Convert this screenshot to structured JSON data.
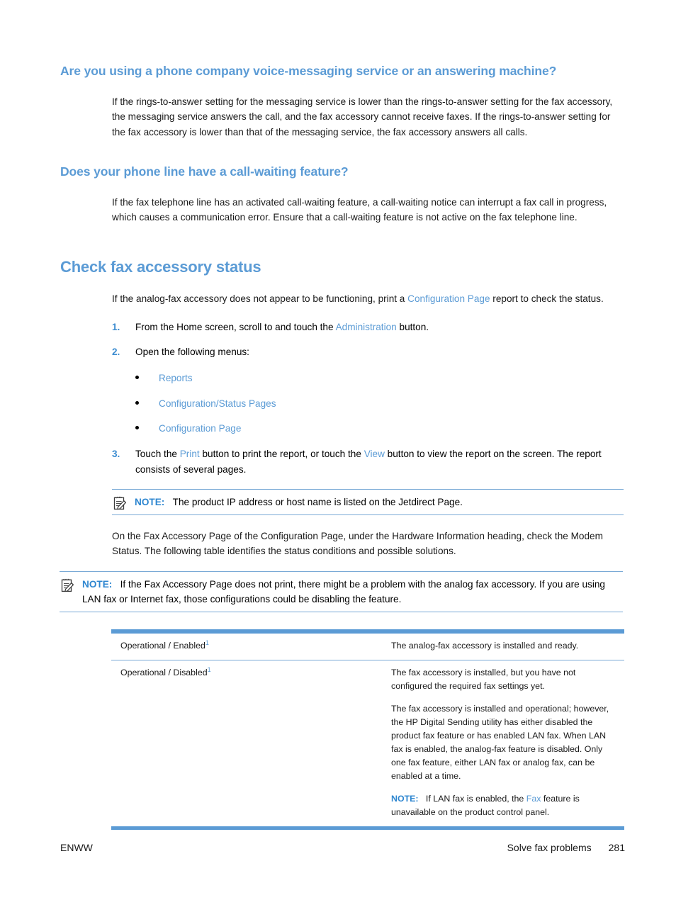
{
  "sections": [
    {
      "heading": "Are you using a phone company voice-messaging service or an answering machine?",
      "body": "If the rings-to-answer setting for the messaging service is lower than the rings-to-answer setting for the fax accessory, the messaging service answers the call, and the fax accessory cannot receive faxes. If the rings-to-answer setting for the fax accessory is lower than that of the messaging service, the fax accessory answers all calls."
    },
    {
      "heading": "Does your phone line have a call-waiting feature?",
      "body": "If the fax telephone line has an activated call-waiting feature, a call-waiting notice can interrupt a fax call in progress, which causes a communication error. Ensure that a call-waiting feature is not active on the fax telephone line."
    }
  ],
  "main_section": {
    "heading": "Check fax accessory status",
    "intro_before": "If the analog-fax accessory does not appear to be functioning, print a ",
    "intro_link": "Configuration Page",
    "intro_after": " report to check the status.",
    "steps": [
      {
        "num": "1.",
        "before": "From the Home screen, scroll to and touch the ",
        "link": "Administration",
        "after": " button."
      },
      {
        "num": "2.",
        "before": "Open the following menus:",
        "link": "",
        "after": ""
      },
      {
        "num": "3.",
        "before": "Touch the ",
        "link": "Print",
        "mid": " button to print the report, or touch the ",
        "link2": "View",
        "after": " button to view the report on the screen. The report consists of several pages."
      }
    ],
    "menus": [
      "Reports",
      "Configuration/Status Pages",
      "Configuration Page"
    ],
    "note1": {
      "label": "NOTE:",
      "text": "The product IP address or host name is listed on the Jetdirect Page.",
      "icon": "note-pencil-icon"
    },
    "after_note_para": "On the Fax Accessory Page of the Configuration Page, under the Hardware Information heading, check the Modem Status. The following table identifies the status conditions and possible solutions.",
    "note2": {
      "label": "NOTE:",
      "text": "If the Fax Accessory Page does not print, there might be a problem with the analog fax accessory. If you are using LAN fax or Internet fax, those configurations could be disabling the feature.",
      "icon": "note-pencil-icon"
    }
  },
  "table": {
    "rows": [
      {
        "status": "Operational / Enabled",
        "footnote": "1",
        "paras": [
          "The analog-fax accessory is installed and ready."
        ],
        "nested_note": null
      },
      {
        "status": "Operational / Disabled",
        "footnote": "1",
        "paras": [
          "The fax accessory is installed, but you have not configured the required fax settings yet.",
          "The fax accessory is installed and operational; however, the HP Digital Sending utility has either disabled the product fax feature or has enabled LAN fax. When LAN fax is enabled, the analog-fax feature is disabled. Only one fax feature, either LAN fax or analog fax, can be enabled at a time."
        ],
        "nested_note": {
          "label": "NOTE:",
          "before": "If LAN fax is enabled, the ",
          "link": "Fax",
          "after": " feature is unavailable on the product control panel."
        }
      }
    ]
  },
  "footer": {
    "left": "ENWW",
    "section": "Solve fax problems",
    "page": "281"
  },
  "colors": {
    "heading_blue": "#5B9BD5",
    "link_blue": "#5B9BD5",
    "note_blue": "#2E86D0",
    "rule_blue": "#79A9D6"
  }
}
